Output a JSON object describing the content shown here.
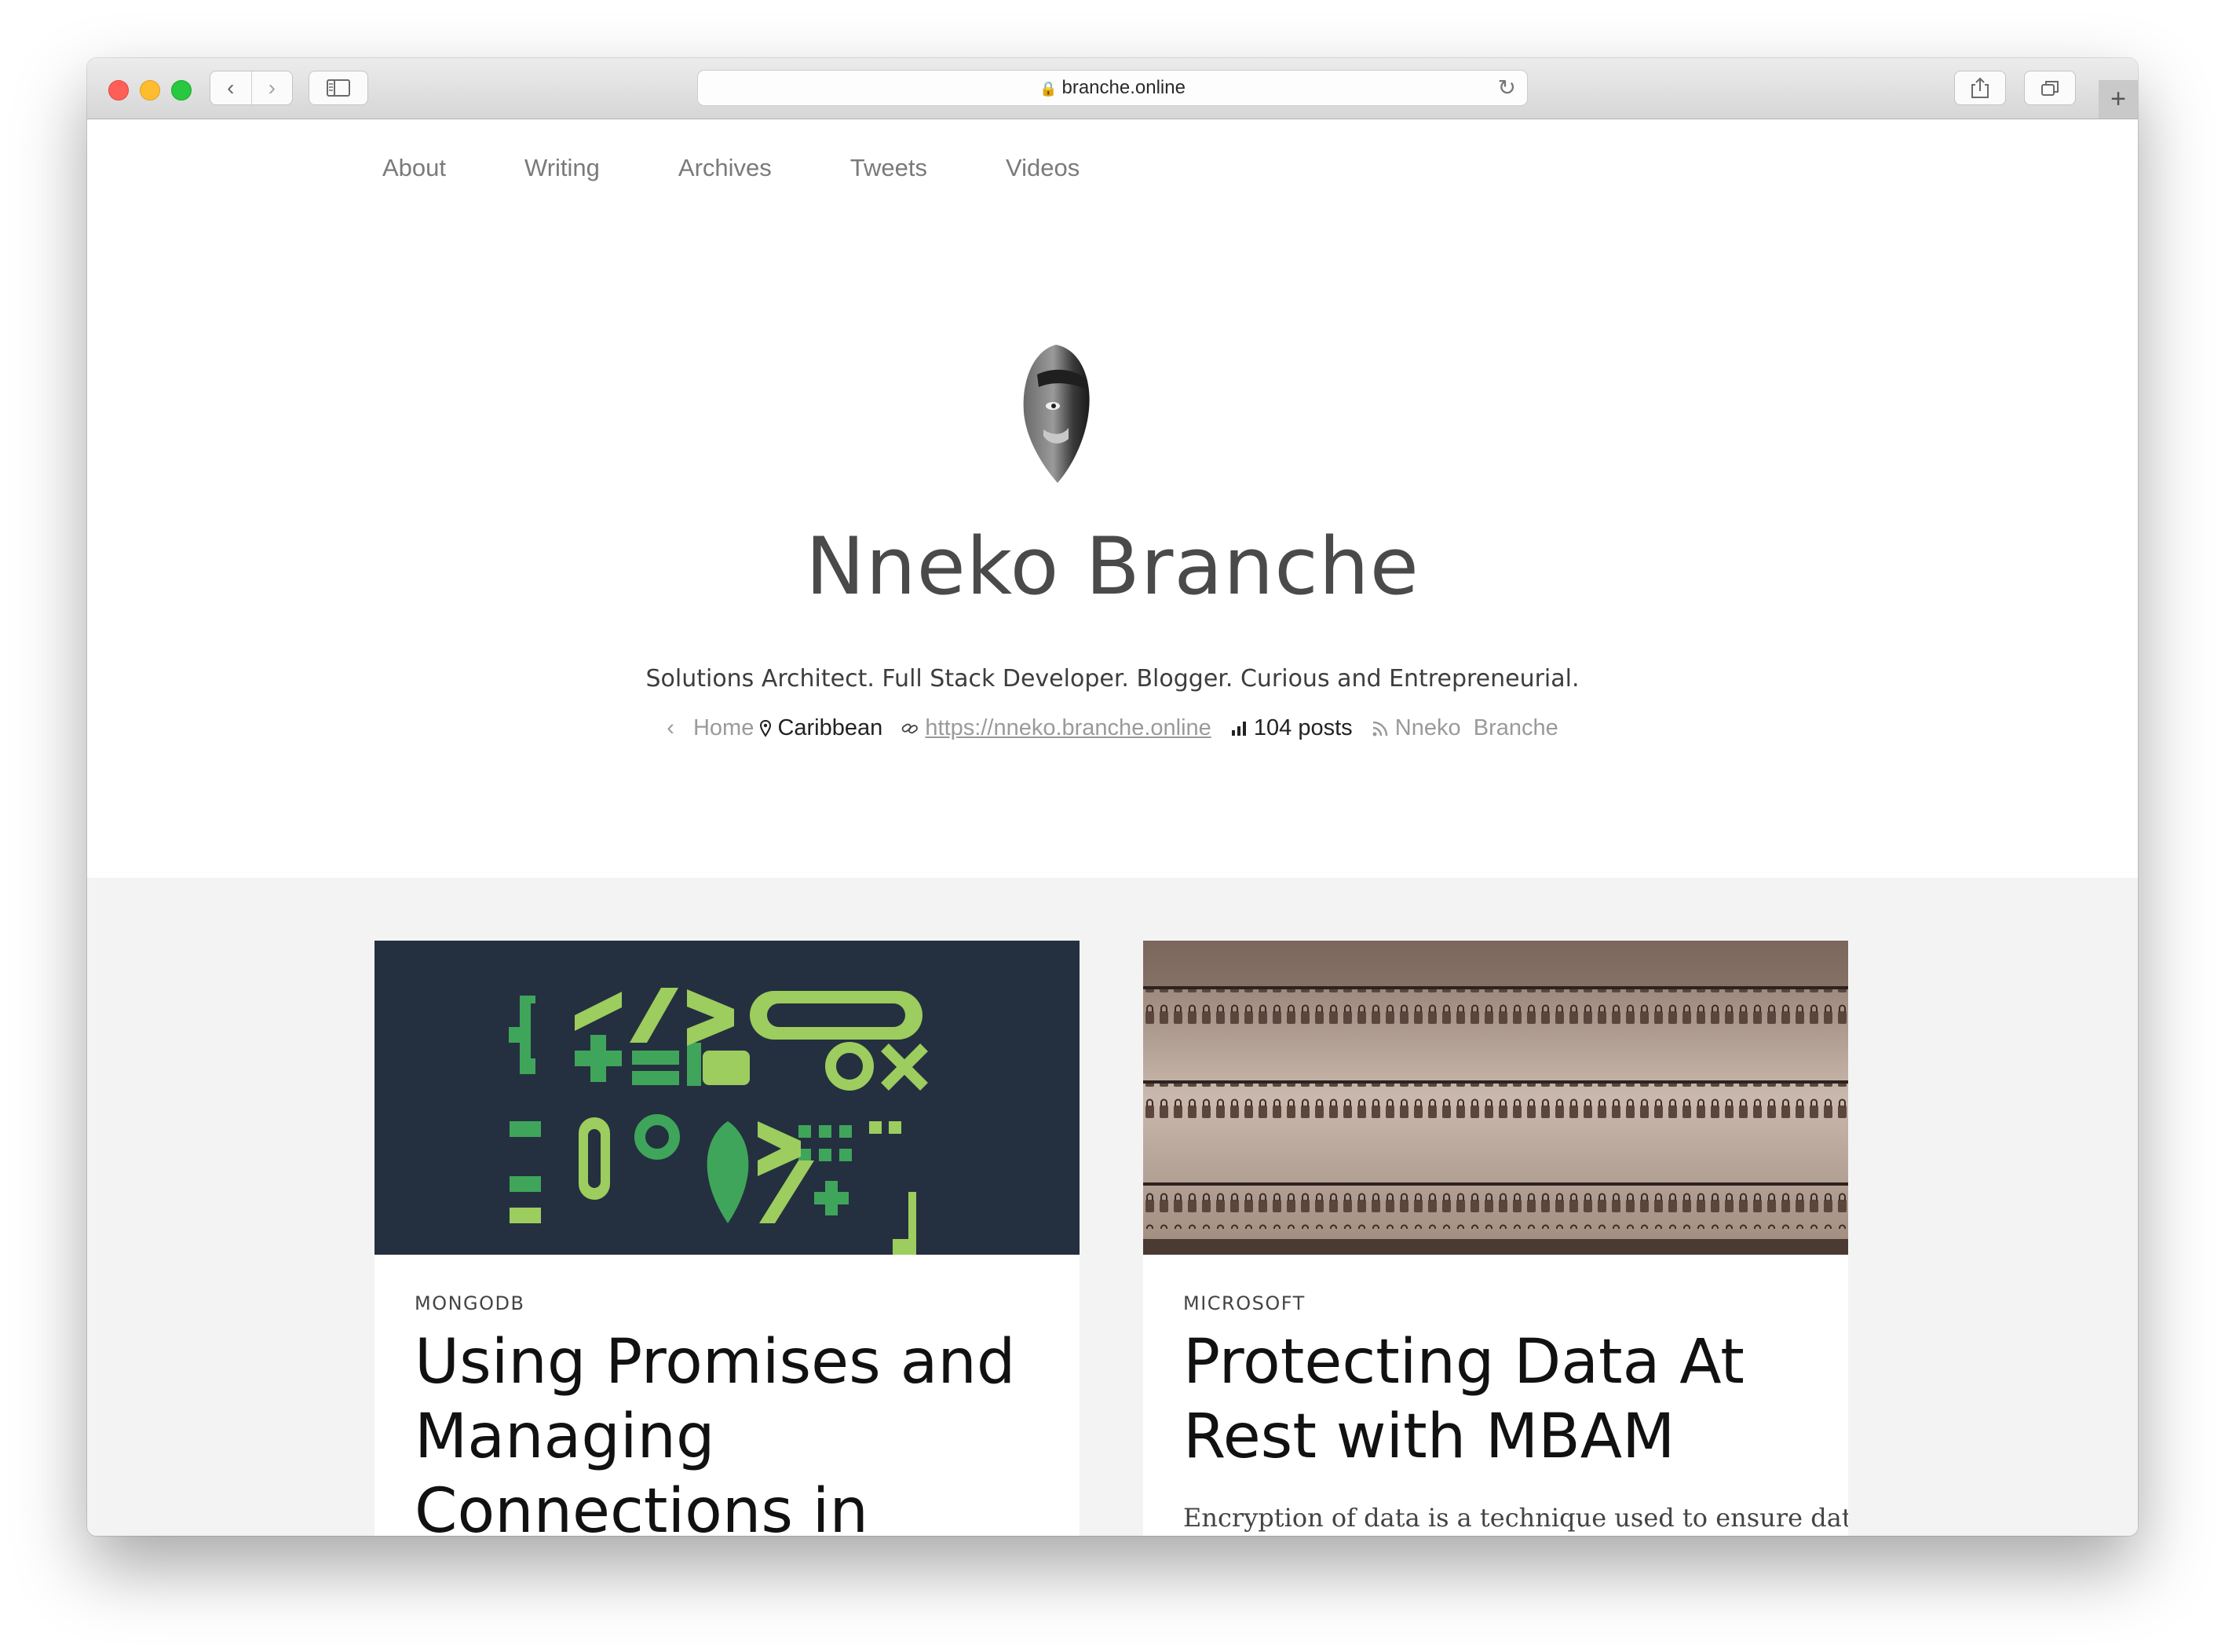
{
  "browser": {
    "url": "branche.online",
    "icons": [
      "back-icon",
      "forward-icon",
      "sidebar-icon",
      "lock-icon",
      "reload-icon",
      "share-icon",
      "tabs-icon",
      "plus-icon"
    ]
  },
  "nav": {
    "items": [
      {
        "label": "About"
      },
      {
        "label": "Writing"
      },
      {
        "label": "Archives"
      },
      {
        "label": "Tweets"
      },
      {
        "label": "Videos"
      }
    ]
  },
  "profile": {
    "name": "Nneko Branche",
    "tagline": "Solutions Architect. Full Stack Developer. Blogger. Curious and Entrepreneurial.",
    "home_label": "Home",
    "location": "Caribbean",
    "website": "https://nneko.branche.online",
    "post_count": "104 posts",
    "rss_label": "Nneko  Branche"
  },
  "posts": [
    {
      "category": "MONGODB",
      "title": "Using Promises and Managing Connections in MongoDB with",
      "image_colors": {
        "background": "#243040",
        "green": "#3fa55a",
        "lime": "#9ccd5e"
      }
    },
    {
      "category": "MICROSOFT",
      "title": "Protecting Data At Rest with MBAM",
      "excerpt": "Encryption of data is a technique used to ensure data is"
    }
  ],
  "colors": {
    "accent_gray": "#f3f3f3",
    "text_muted": "#9a9a9a"
  }
}
